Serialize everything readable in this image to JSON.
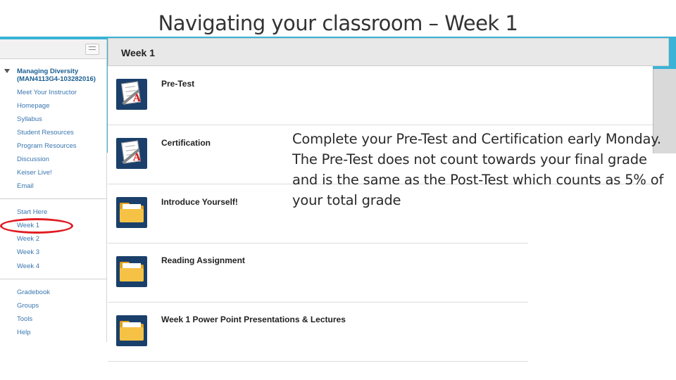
{
  "slide": {
    "title": "Navigating your classroom – Week 1",
    "callout": "Complete your Pre-Test and Certification early Monday.  The Pre-Test does not count towards your final grade and is the same as the Post-Test which counts as 5% of your total grade"
  },
  "colors": {
    "accent_band": "#3ab3d6",
    "link": "#3a76b0",
    "highlight": "#e11b22",
    "folder": "#f6c245"
  },
  "sidebar": {
    "course_name": "Managing Diversity (MAN4113G4-103282016)",
    "group1": [
      "Meet Your Instructor",
      "Homepage",
      "Syllabus",
      "Student Resources",
      "Program Resources",
      "Discussion",
      "Keiser Live!",
      "Email"
    ],
    "group2": [
      "Start Here",
      "Week 1",
      "Week 2",
      "Week 3",
      "Week 4"
    ],
    "group3": [
      "Gradebook",
      "Groups",
      "Tools",
      "Help"
    ]
  },
  "content": {
    "header": "Week 1",
    "items": [
      {
        "label": "Pre-Test",
        "icon": "test-icon"
      },
      {
        "label": "Certification",
        "icon": "test-icon"
      },
      {
        "label": "Introduce Yourself!",
        "icon": "folder-icon"
      },
      {
        "label": "Reading Assignment",
        "icon": "folder-icon"
      },
      {
        "label": "Week 1 Power Point Presentations & Lectures",
        "icon": "folder-icon"
      }
    ]
  }
}
